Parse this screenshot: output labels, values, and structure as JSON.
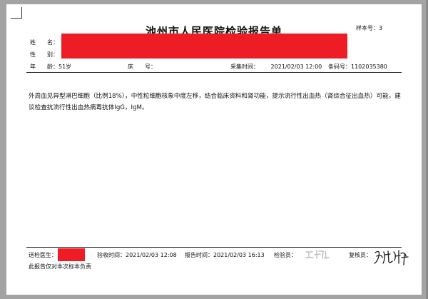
{
  "report": {
    "title": "池州市人民医院检验报告单",
    "sample_label": "样本号：",
    "sample_no": "3"
  },
  "patient": {
    "name_label": "姓　　名：",
    "sex_label": "性　　别：",
    "age_label": "年　　龄：",
    "age_value": "51岁",
    "bed_label": "床　　号：",
    "collect_label": "采集时间：",
    "collect_value": "2021/02/03 12:00",
    "barcode_label": "条码号：",
    "barcode_value": "1102035380"
  },
  "result": {
    "comment": "外周血见异型淋巴细胞（比例18%），中性粒细胞核象中度左移，结合临床资料和肾功能，提示流行性出血热（肾综合征出血热）可能，建议检查抗流行性出血热病毒抗体IgG，IgM。"
  },
  "footer": {
    "doctor_label": "送检医生：",
    "receive_label": "验收时间：",
    "receive_value": "2021/02/03 12:08",
    "report_time_label": "报告时间：",
    "report_time_value": "2021/02/03 16:13",
    "tester_label": "检验员：",
    "reviewer_label": "复核员：",
    "disclaimer": "此报告仅对本次标本负责"
  },
  "colors": {
    "redaction": "#ee1c25",
    "window_background": "#a3a3a3",
    "paper": "#ffffff"
  }
}
